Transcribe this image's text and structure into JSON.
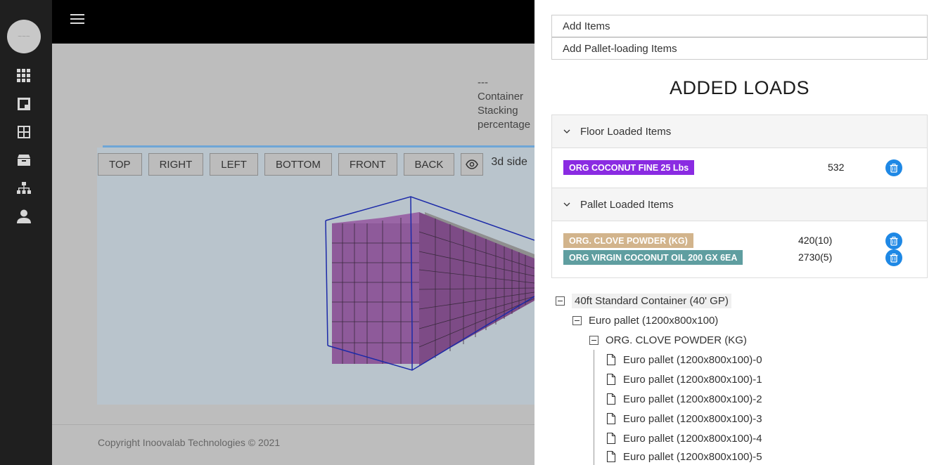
{
  "header": {
    "menu_icon": "hamburger-icon"
  },
  "rail": {
    "avatar_text": "~~~",
    "items": [
      {
        "icon": "grid-icon"
      },
      {
        "icon": "floorplan-icon"
      },
      {
        "icon": "layout-icon"
      },
      {
        "icon": "box-icon"
      },
      {
        "icon": "hierarchy-icon"
      },
      {
        "icon": "user-icon"
      }
    ]
  },
  "main": {
    "stack_info": {
      "dashes": "---",
      "line1": "Container",
      "line2": "Stacking",
      "line3": "percentage"
    },
    "view_buttons": [
      "TOP",
      "RIGHT",
      "LEFT",
      "BOTTOM",
      "FRONT",
      "BACK"
    ],
    "side_label": "3d side",
    "copyright": "Copyright Inoovalab Technologies © 2021"
  },
  "drawer": {
    "add_items": "Add Items",
    "add_pallet_items": "Add Pallet-loading Items",
    "title": "ADDED LOADS",
    "floor": {
      "header": "Floor Loaded Items",
      "items": [
        {
          "name": "ORG COCONUT FINE 25 Lbs",
          "qty": "532",
          "color": "#8a2be2"
        }
      ]
    },
    "pallet": {
      "header": "Pallet Loaded Items",
      "items": [
        {
          "name": "ORG. CLOVE POWDER (KG)",
          "qty": "420(10)",
          "color": "#d2b48c"
        },
        {
          "name": "ORG VIRGIN COCONUT OIL 200 GX 6EA",
          "qty": "2730(5)",
          "color": "#5f9ea0"
        }
      ]
    },
    "tree": {
      "root": "40ft Standard Container (40' GP)",
      "pallet": "Euro pallet (1200x800x100)",
      "product": "ORG. CLOVE POWDER (KG)",
      "leaves": [
        "Euro pallet (1200x800x100)-0",
        "Euro pallet (1200x800x100)-1",
        "Euro pallet (1200x800x100)-2",
        "Euro pallet (1200x800x100)-3",
        "Euro pallet (1200x800x100)-4",
        "Euro pallet (1200x800x100)-5"
      ]
    }
  }
}
